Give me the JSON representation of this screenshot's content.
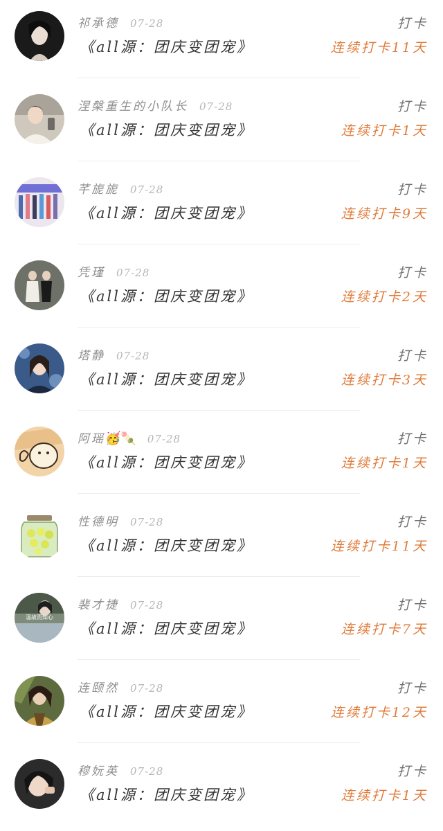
{
  "list": {
    "items": [
      {
        "name": "祁承德",
        "date": "07-28",
        "title": "《all源：团庆变团宠》",
        "action": "打卡",
        "streak": "连续打卡11天",
        "emoji": ""
      },
      {
        "name": "涅槃重生的小队长",
        "date": "07-28",
        "title": "《all源：团庆变团宠》",
        "action": "打卡",
        "streak": "连续打卡1天",
        "emoji": ""
      },
      {
        "name": "芊旎旎",
        "date": "07-28",
        "title": "《all源：团庆变团宠》",
        "action": "打卡",
        "streak": "连续打卡9天",
        "emoji": ""
      },
      {
        "name": "凭瑾",
        "date": "07-28",
        "title": "《all源：团庆变团宠》",
        "action": "打卡",
        "streak": "连续打卡2天",
        "emoji": ""
      },
      {
        "name": "塔静",
        "date": "07-28",
        "title": "《all源：团庆变团宠》",
        "action": "打卡",
        "streak": "连续打卡3天",
        "emoji": ""
      },
      {
        "name": "阿瑶",
        "date": "07-28",
        "title": "《all源：团庆变团宠》",
        "action": "打卡",
        "streak": "连续打卡1天",
        "emoji": "🥳🍡"
      },
      {
        "name": "性德明",
        "date": "07-28",
        "title": "《all源：团庆变团宠》",
        "action": "打卡",
        "streak": "连续打卡11天",
        "emoji": ""
      },
      {
        "name": "裴才捷",
        "date": "07-28",
        "title": "《all源：团庆变团宠》",
        "action": "打卡",
        "streak": "连续打卡7天",
        "emoji": ""
      },
      {
        "name": "连颐然",
        "date": "07-28",
        "title": "《all源：团庆变团宠》",
        "action": "打卡",
        "streak": "连续打卡12天",
        "emoji": ""
      },
      {
        "name": "穆妧英",
        "date": "07-28",
        "title": "《all源：团庆变团宠》",
        "action": "打卡",
        "streak": "连续打卡1天",
        "emoji": ""
      }
    ],
    "avatar_overlay_text": "温故而知心"
  },
  "colors": {
    "streak": "#e07b3a",
    "action": "#707070",
    "title": "#333333",
    "meta": "#9a9a9a"
  }
}
